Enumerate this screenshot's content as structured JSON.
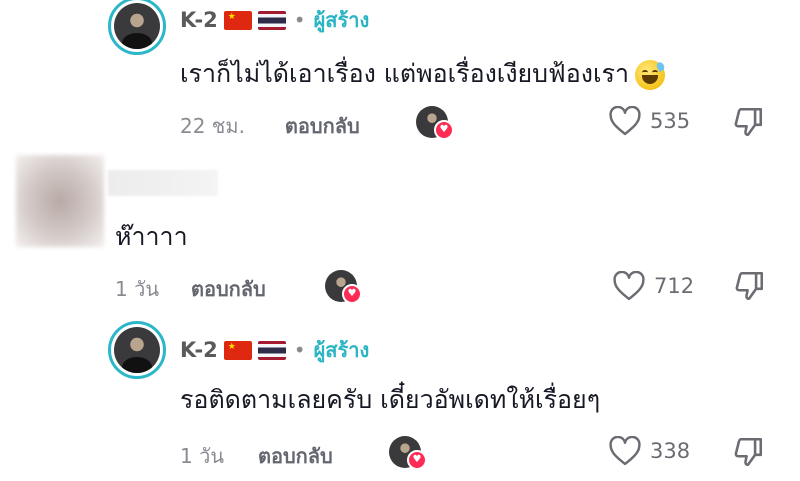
{
  "comments": [
    {
      "username": "K-2",
      "flags": [
        "china-flag",
        "thailand-flag"
      ],
      "separator": "•",
      "badge": "ผู้สร้าง",
      "text": "เราก็ไม่ได้เอาเรื่อง แต่พอเรื่องเงียบฟ้องเรา",
      "emoji": "grinning-sweat-emoji",
      "time": "22 ชม.",
      "reply_label": "ตอบกลับ",
      "likes": "535"
    },
    {
      "username": "",
      "text": "ห๊าาาา",
      "time": "1 วัน",
      "reply_label": "ตอบกลับ",
      "likes": "712"
    },
    {
      "username": "K-2",
      "flags": [
        "china-flag",
        "thailand-flag"
      ],
      "separator": "•",
      "badge": "ผู้สร้าง",
      "text": "รอติดตามเลยครับ เดี๋ยวอัพเดทให้เรื่อยๆ",
      "time": "1 วัน",
      "reply_label": "ตอบกลับ",
      "likes": "338"
    }
  ],
  "colors": {
    "accent": "#2ab4c5",
    "heart": "#fe2c55",
    "muted": "#8a8b91"
  }
}
